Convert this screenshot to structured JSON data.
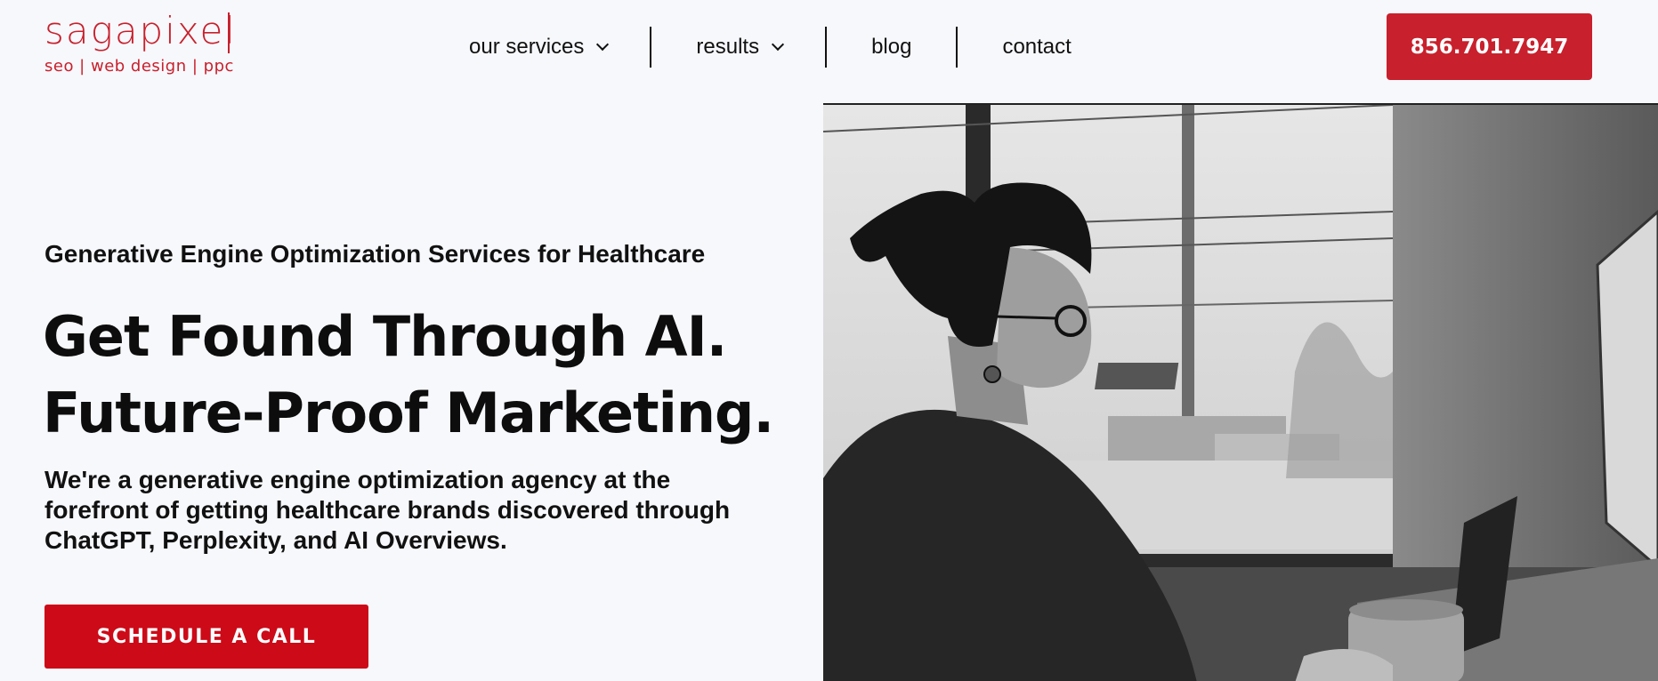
{
  "logo": {
    "wordmark": "sagapixel",
    "tagline": "seo | web design | ppc"
  },
  "nav": {
    "items": [
      {
        "label": "our services",
        "has_dropdown": true
      },
      {
        "label": "results",
        "has_dropdown": true
      },
      {
        "label": "blog",
        "has_dropdown": false
      },
      {
        "label": "contact",
        "has_dropdown": false
      }
    ],
    "phone": "856.701.7947"
  },
  "hero": {
    "kicker": "Generative Engine Optimization Services for Healthcare",
    "headline_line1": "Get Found Through AI.",
    "headline_line2": "Future-Proof Marketing.",
    "subtext": "We're a generative engine optimization agency at the forefront of getting healthcare brands discovered through ChatGPT, Perplexity, and AI Overviews.",
    "cta_label": "SCHEDULE A CALL"
  },
  "colors": {
    "brand_red": "#c8202c",
    "cta_red": "#cc0a18",
    "background": "#f7f8fc",
    "text": "#111111"
  }
}
